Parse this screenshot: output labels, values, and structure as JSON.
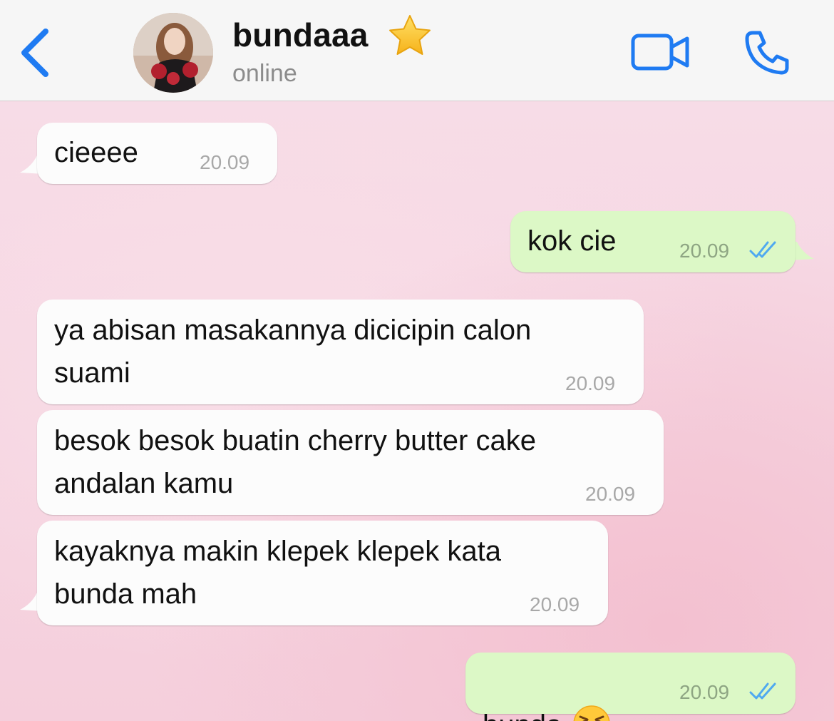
{
  "header": {
    "contact_name": "bundaaa",
    "status": "online",
    "icons": {
      "back": "chevron-left-icon",
      "star": "star-icon",
      "video": "video-camera-icon",
      "call": "phone-icon"
    },
    "accent_color": "#1f7bf2"
  },
  "messages": [
    {
      "direction": "incoming",
      "text": "cieeee",
      "time": "20.09"
    },
    {
      "direction": "outgoing",
      "text": "kok cie",
      "time": "20.09",
      "status": "read"
    },
    {
      "direction": "incoming",
      "text": "ya abisan masakannya dicicipin calon\nsuami",
      "time": "20.09"
    },
    {
      "direction": "incoming",
      "text": "besok besok buatin cherry butter cake\nandalan kamu",
      "time": "20.09"
    },
    {
      "direction": "incoming",
      "text": "kayaknya makin klepek klepek kata\nbunda mah",
      "time": "20.09"
    },
    {
      "direction": "outgoing",
      "text": "bunda",
      "emoji": "😤",
      "time": "20.09",
      "status": "read"
    }
  ],
  "colors": {
    "incoming_bubble": "#fcfcfc",
    "outgoing_bubble": "#dcf8c6",
    "read_tick": "#4fa9f0",
    "chat_background": "#f7dbe6"
  }
}
